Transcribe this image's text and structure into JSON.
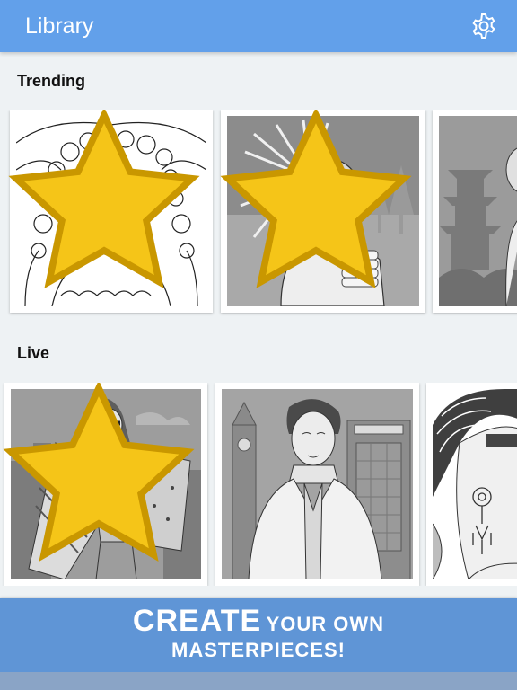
{
  "header": {
    "title": "Library",
    "settings_icon": "gear-icon"
  },
  "sections": {
    "trending": {
      "title": "Trending",
      "items": [
        {
          "name": "floral-woman",
          "starred": true
        },
        {
          "name": "headdress-woman",
          "starred": true
        },
        {
          "name": "pagoda-scene",
          "starred": false
        }
      ]
    },
    "live": {
      "title": "Live",
      "items": [
        {
          "name": "flag-woman",
          "starred": true
        },
        {
          "name": "london-man",
          "starred": false
        },
        {
          "name": "earring-woman",
          "starred": false
        }
      ]
    }
  },
  "banner": {
    "word_create": "CREATE",
    "word_rest": "YOUR OWN",
    "line2": "MASTERPIECES!"
  },
  "colors": {
    "header": "#62a0ea",
    "banner": "#5f95d6",
    "background": "#eef2f4",
    "star": "#f5c518"
  }
}
